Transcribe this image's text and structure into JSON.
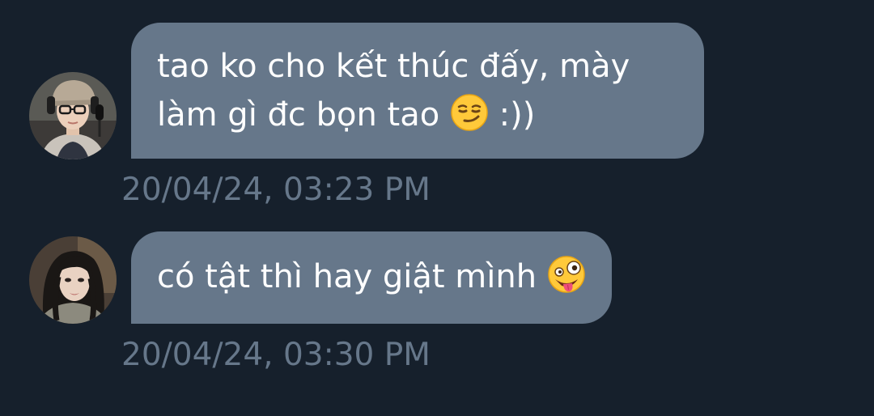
{
  "messages": [
    {
      "text": "tao ko cho kết thúc đấy, mày\nlàm gì đc bọn tao",
      "suffix": " :))",
      "emoji": "smirking-face-icon",
      "timestamp": "20/04/24, 03:23 PM",
      "avatar": "avatar-girl-with-cap-and-headphones"
    },
    {
      "text": "có tật thì hay giật mình",
      "suffix": "",
      "emoji": "zany-face-icon",
      "timestamp": "20/04/24, 03:30 PM",
      "avatar": "avatar-girl-dark-hair"
    }
  ],
  "colors": {
    "background": "#16202c",
    "bubble": "#66778a",
    "bubble_text": "#ffffff",
    "timestamp": "#66778a"
  }
}
